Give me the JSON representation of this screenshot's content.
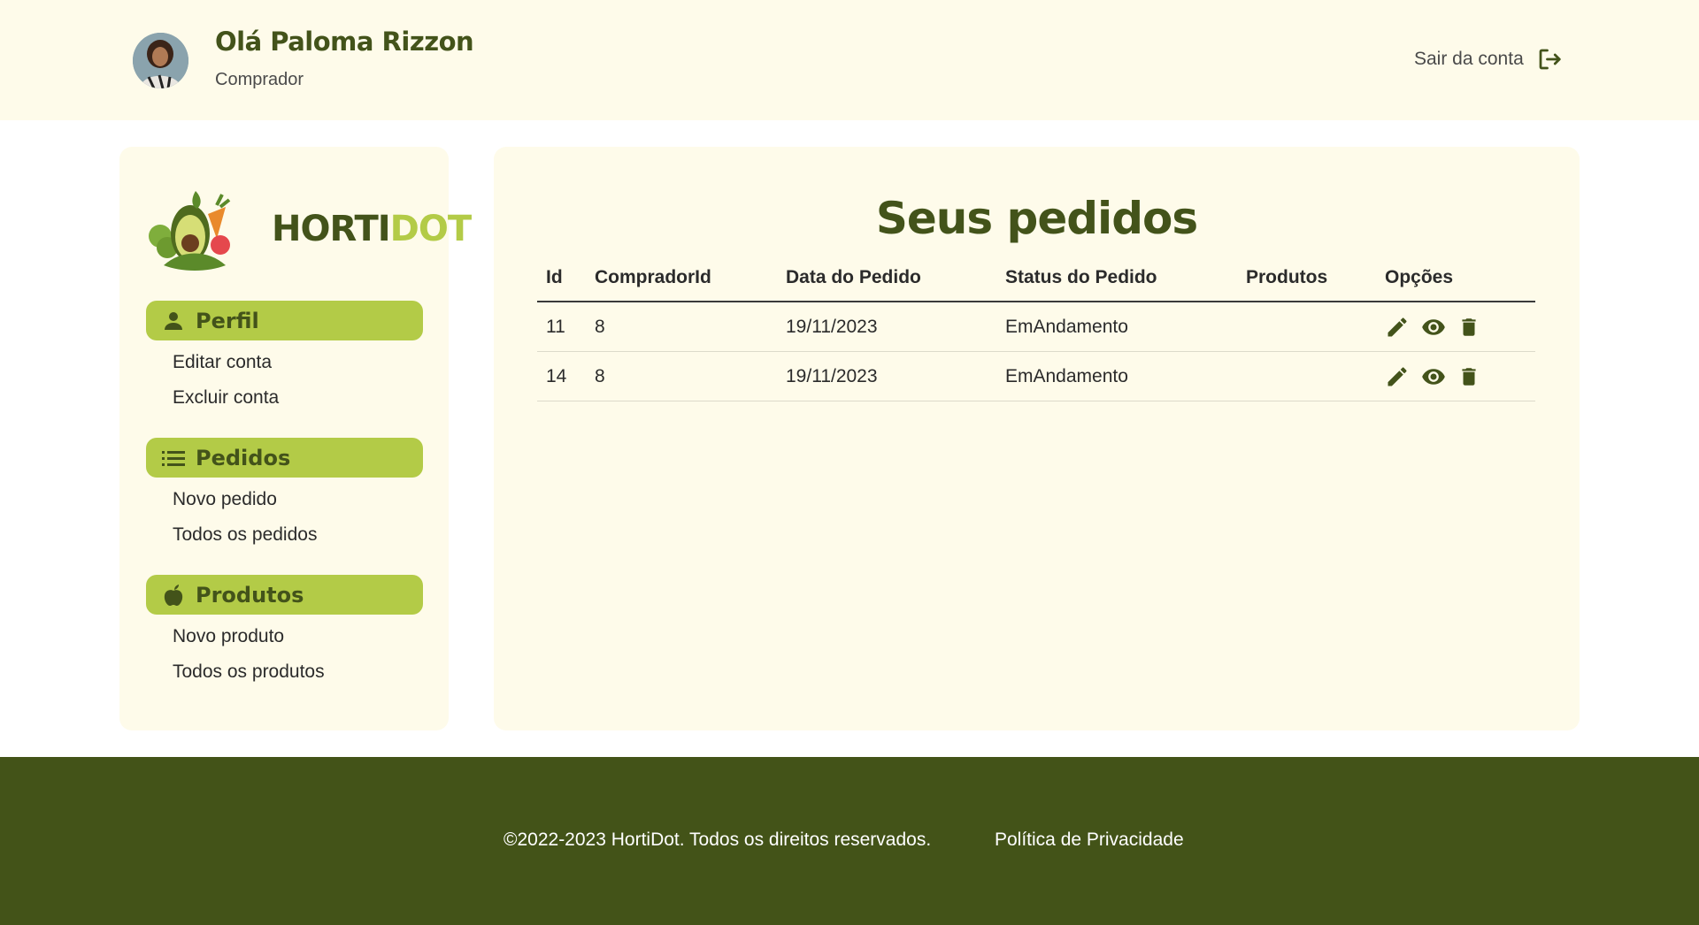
{
  "header": {
    "greeting": "Olá Paloma Rizzon",
    "role": "Comprador",
    "logout_label": "Sair da conta"
  },
  "sidebar": {
    "brand_part1": "HORTI",
    "brand_part2": "DOT",
    "sections": [
      {
        "label": "Perfil",
        "icon": "user-icon",
        "links": [
          "Editar conta",
          "Excluir conta"
        ]
      },
      {
        "label": "Pedidos",
        "icon": "list-icon",
        "links": [
          "Novo pedido",
          "Todos os pedidos"
        ]
      },
      {
        "label": "Produtos",
        "icon": "apple-icon",
        "links": [
          "Novo produto",
          "Todos os produtos"
        ]
      }
    ]
  },
  "main": {
    "title": "Seus pedidos",
    "columns": [
      "Id",
      "CompradorId",
      "Data do Pedido",
      "Status do Pedido",
      "Produtos",
      "Opções"
    ],
    "rows": [
      {
        "id": "11",
        "comprador": "8",
        "data": "19/11/2023",
        "status": "EmAndamento",
        "produtos": ""
      },
      {
        "id": "14",
        "comprador": "8",
        "data": "19/11/2023",
        "status": "EmAndamento",
        "produtos": ""
      }
    ],
    "row_actions": [
      "edit-icon",
      "eye-icon",
      "trash-icon"
    ]
  },
  "footer": {
    "copyright": "©2022-2023 HortiDot. Todos os direitos reservados.",
    "privacy": "Política de Privacidade"
  },
  "colors": {
    "cream": "#fefbea",
    "lime": "#b3cb47",
    "dark_green": "#43531a",
    "footer_green": "#435318"
  }
}
